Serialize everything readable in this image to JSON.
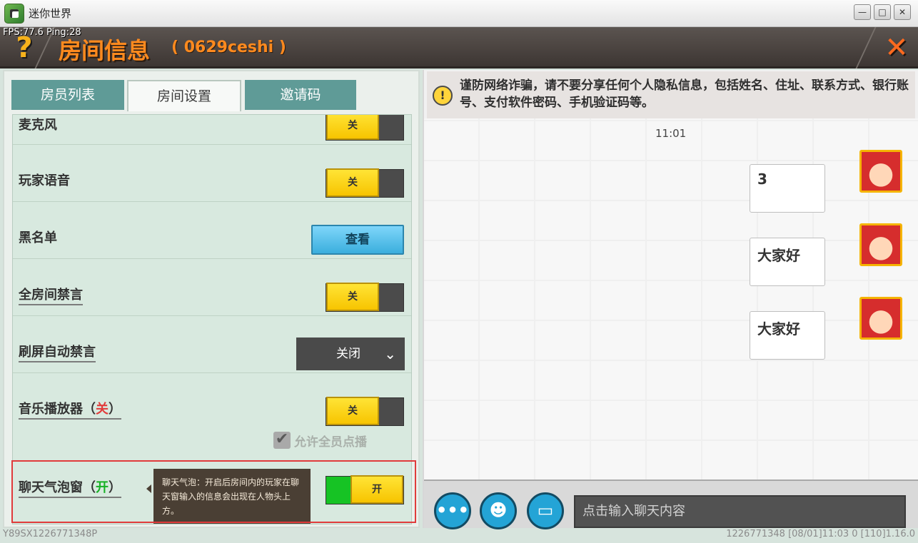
{
  "app": {
    "title": "迷你世界",
    "icon": "game-app-icon"
  },
  "window_controls": {
    "minimize": "—",
    "maximize": "□",
    "close": "✕"
  },
  "fps": "FPS:77.6  Ping:28",
  "header": {
    "help": "?",
    "title": "房间信息",
    "subtitle": "( 0629ceshi )",
    "close": "✕",
    "accent": "#ff8a1e"
  },
  "tabs": [
    {
      "label": "房员列表",
      "active": false
    },
    {
      "label": "房间设置",
      "active": true
    },
    {
      "label": "邀请码",
      "active": false
    }
  ],
  "settings": {
    "mic": {
      "label": "麦克风",
      "toggle": "关"
    },
    "player_voice": {
      "label": "玩家语音",
      "toggle": "关"
    },
    "blacklist": {
      "label": "黑名单",
      "button": "查看"
    },
    "mute_all": {
      "label": "全房间禁言",
      "toggle": "关"
    },
    "auto_mute": {
      "label": "刷屏自动禁言",
      "value": "关闭"
    },
    "music_player": {
      "label": "音乐播放器（",
      "state": "关",
      "label_close": "）",
      "toggle": "关",
      "allow_all": "允许全员点播"
    },
    "chat_bubble": {
      "label": "聊天气泡窗（",
      "state": "开",
      "label_close": "）",
      "toggle": "开",
      "tooltip": "聊天气泡：开启后房间内的玩家在聊天窗输入的信息会出现在人物头上方。"
    }
  },
  "notice": {
    "icon": "!",
    "text": "谨防网络诈骗，请不要分享任何个人隐私信息，包括姓名、住址、联系方式、银行账号、支付软件密码、手机验证码等。"
  },
  "chat": {
    "time": "11:01",
    "messages": [
      "3",
      "大家好",
      "大家好"
    ]
  },
  "input": {
    "placeholder": "点击输入聊天内容",
    "more": "•••",
    "emoji": "☻",
    "bubble": "▭"
  },
  "footer": {
    "left": "Y89SX1226771348P",
    "right": "1226771348    [08/01]11:03 0   [110]1.16.0"
  }
}
